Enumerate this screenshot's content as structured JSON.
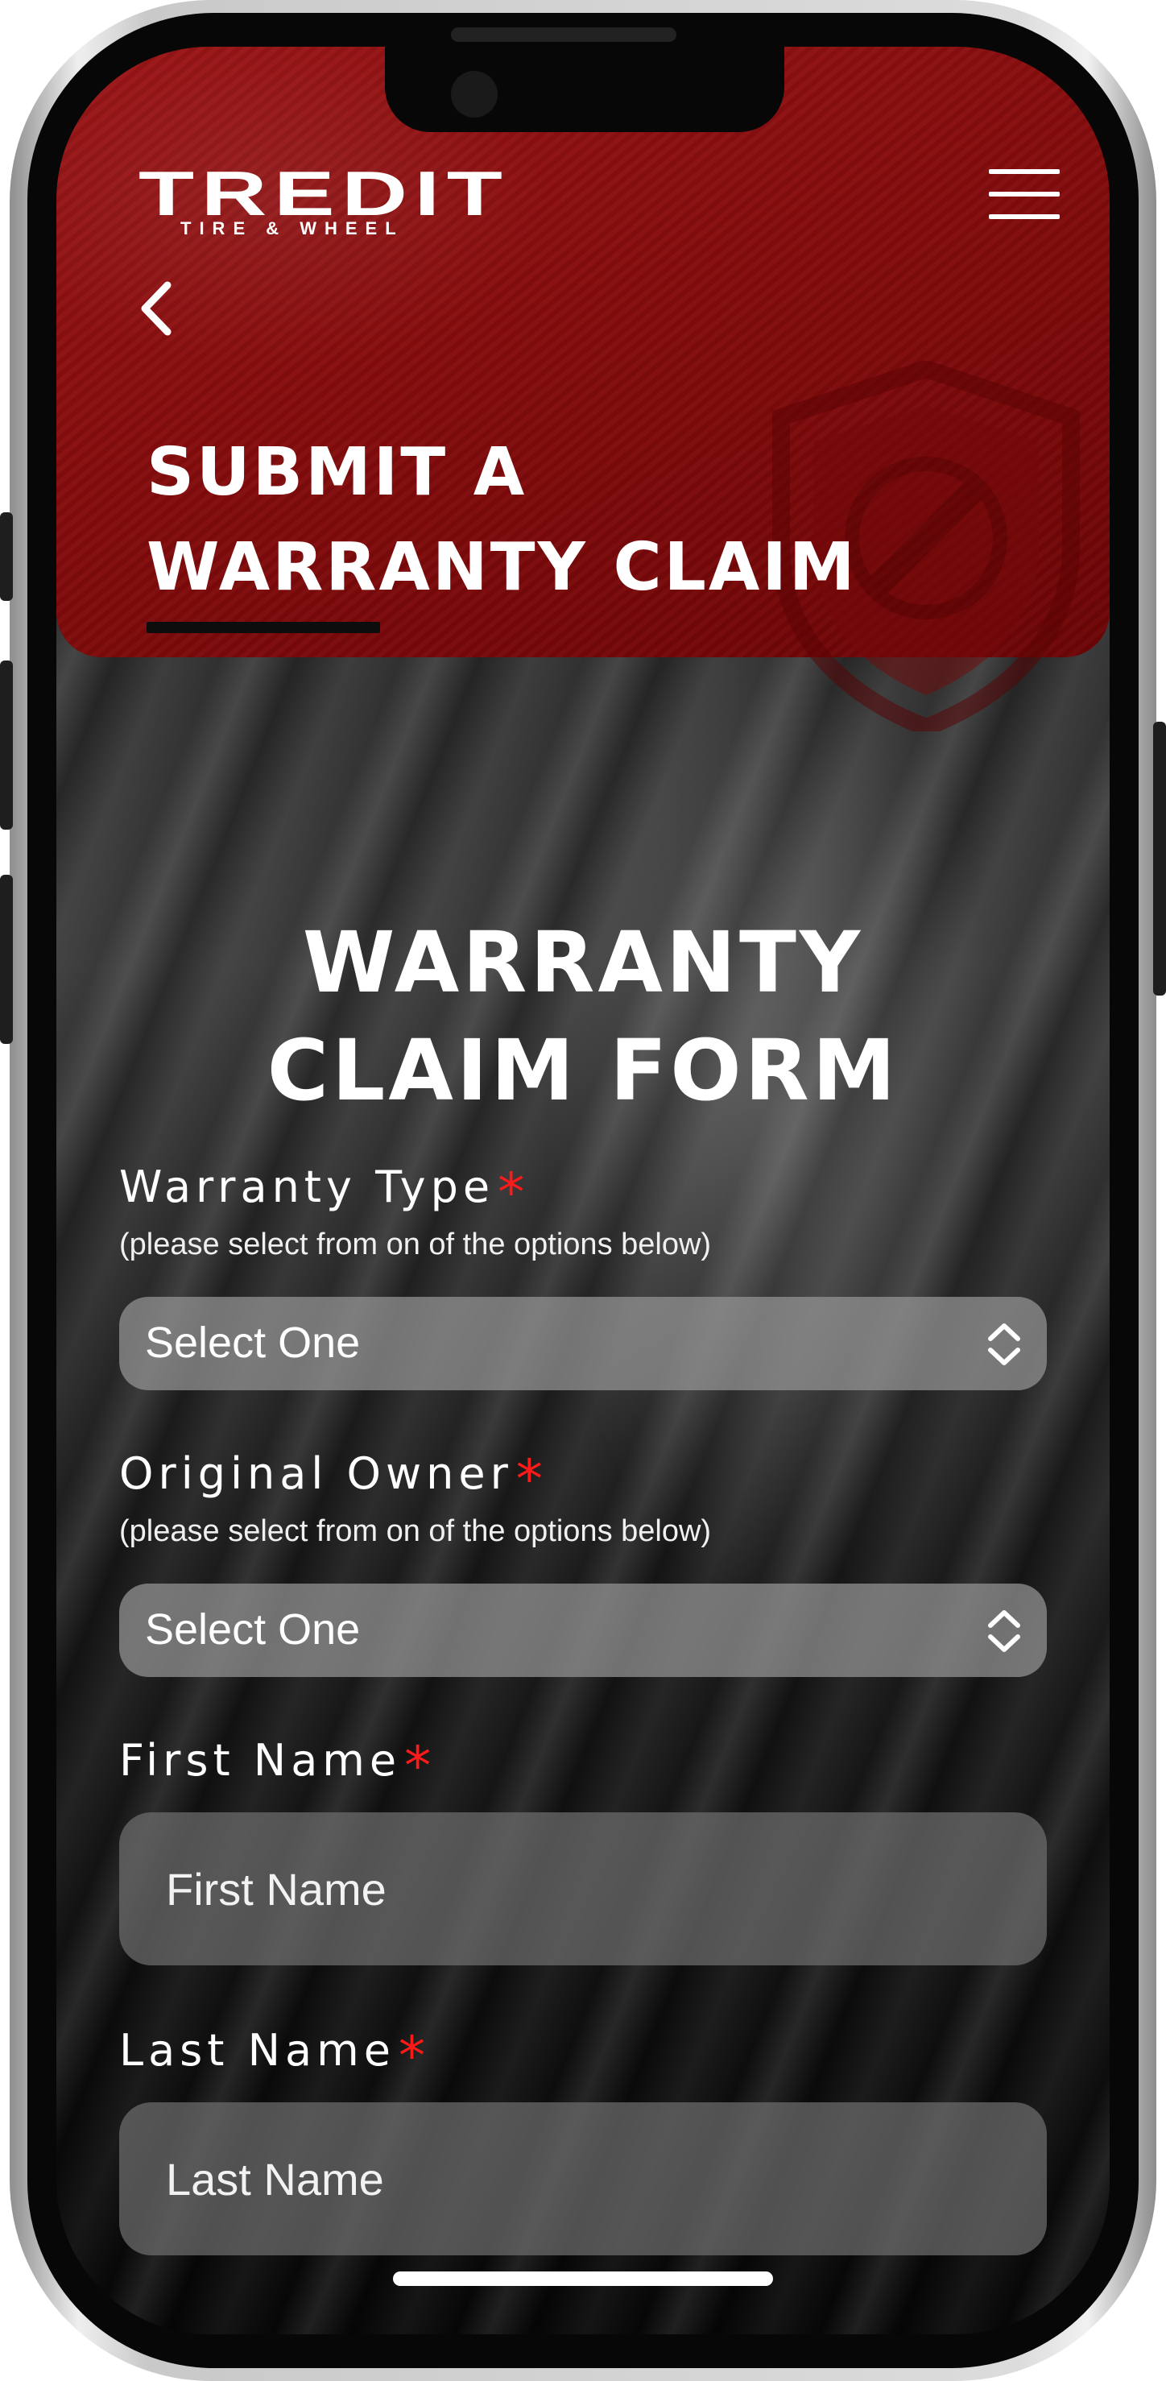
{
  "brand": {
    "name": "TREDIT",
    "tagline": "TIRE & WHEEL"
  },
  "header": {
    "title_line1": "SUBMIT A",
    "title_line2": "WARRANTY CLAIM"
  },
  "form": {
    "title_line1": "WARRANTY",
    "title_line2": "CLAIM FORM",
    "required_marker": "*",
    "fields": {
      "warranty_type": {
        "label": "Warranty Type",
        "hint": "(please select from on of the options below)",
        "value": "Select One"
      },
      "original_owner": {
        "label": "Original Owner",
        "hint": "(please select from on of the options below)",
        "value": "Select One"
      },
      "first_name": {
        "label": "First Name",
        "placeholder": "First Name"
      },
      "last_name": {
        "label": "Last Name",
        "placeholder": "Last Name"
      }
    }
  },
  "icons": {
    "menu": "hamburger-menu-icon",
    "back": "chevron-left-icon",
    "select": "up-down-chevron-icon",
    "shield": "shield-wrench-icon"
  },
  "colors": {
    "header_red": "#8a0f10",
    "required_red": "#ff1a1a",
    "background": "#040404"
  }
}
